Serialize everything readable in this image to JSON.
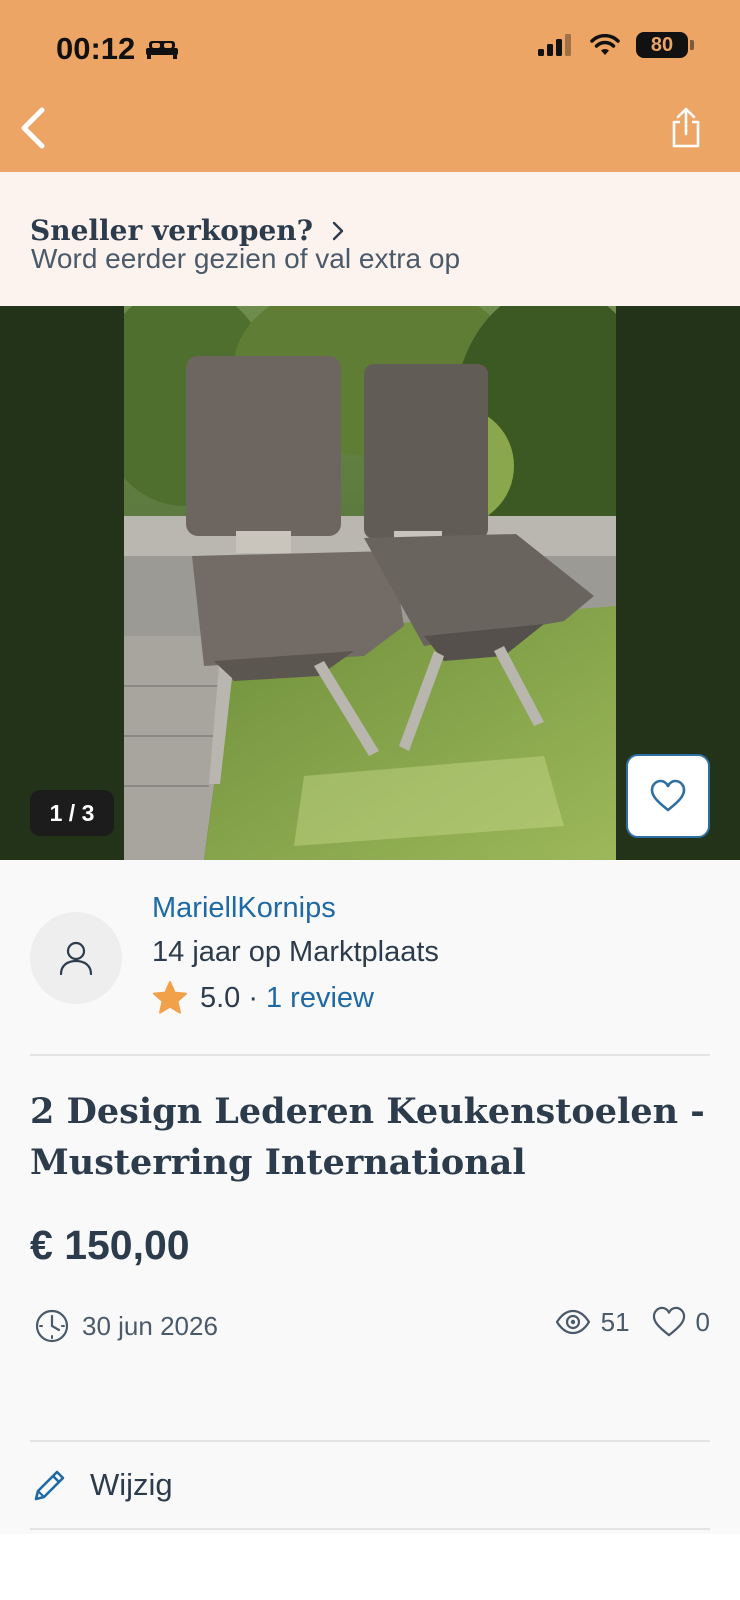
{
  "status_bar": {
    "time": "00:12",
    "battery": "80",
    "icons": [
      "sleep-bed-icon",
      "cellular-signal-icon",
      "wifi-icon",
      "battery-icon"
    ]
  },
  "nav": {
    "back_icon": "chevron-left-icon",
    "share_icon": "share-icon"
  },
  "promo": {
    "title": "Sneller verkopen?",
    "subtitle": "Word eerder gezien of val extra op",
    "icon": "chevron-right-icon"
  },
  "gallery": {
    "counter": "1 / 3",
    "current_image": 1,
    "total_images": 3,
    "favorite_icon": "heart-outline-icon"
  },
  "seller": {
    "name": "MariellKornips",
    "since": "14 jaar op Marktplaats",
    "rating": "5.0",
    "separator": "·",
    "reviews": "1 review",
    "avatar_icon": "user-icon",
    "star_icon": "star-icon"
  },
  "listing": {
    "title": "2 Design Lederen Keukenstoelen - Musterring International",
    "price": "€ 150,00",
    "date": "30 jun 2026",
    "views": "51",
    "favorites": "0"
  },
  "actions": {
    "edit_label": "Wijzig",
    "edit_icon": "pencil-icon"
  },
  "colors": {
    "header_bg": "#eda565",
    "promo_bg": "#fdf3ee",
    "link": "#1f6aa5",
    "text": "#2d3c4d",
    "star": "#f0a14a",
    "gallery_bg": "#23331a"
  }
}
